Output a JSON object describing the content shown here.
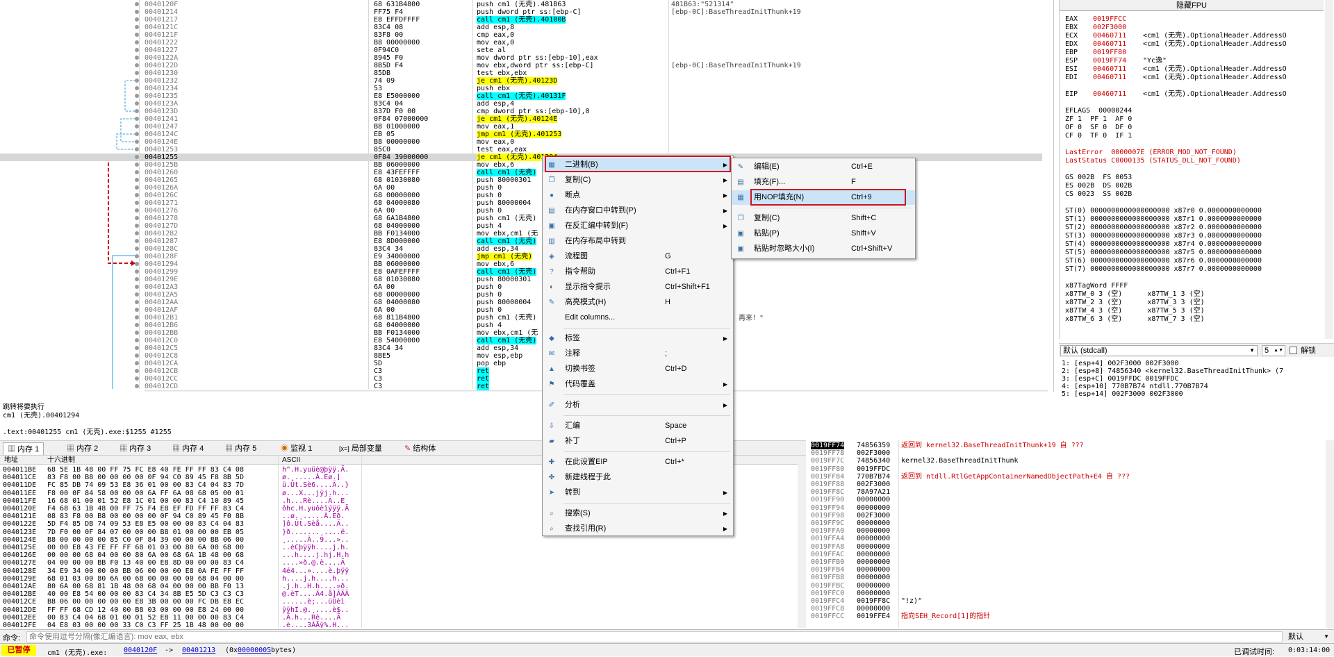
{
  "disasm": {
    "rows": [
      {
        "addr": "0040120F",
        "bytes": "68 631B4800",
        "asm": "push cm1 (无壳).481B63",
        "cmt": "481B63:\"521314\""
      },
      {
        "addr": "00401214",
        "bytes": "FF75 F4",
        "asm": "push dword ptr ss:[ebp-C]",
        "cmt": "[ebp-0C]:BaseThreadInitThunk+19"
      },
      {
        "addr": "00401217",
        "bytes": "E8 EFFDFFFF",
        "asm": "call cm1 (无壳).40100B",
        "cmt": "",
        "hl": "c"
      },
      {
        "addr": "0040121C",
        "bytes": "83C4 08",
        "asm": "add esp,8",
        "cmt": ""
      },
      {
        "addr": "0040121F",
        "bytes": "83F8 00",
        "asm": "cmp eax,0",
        "cmt": ""
      },
      {
        "addr": "00401222",
        "bytes": "B8 00000000",
        "asm": "mov eax,0",
        "cmt": ""
      },
      {
        "addr": "00401227",
        "bytes": "0F94C0",
        "asm": "sete al",
        "cmt": ""
      },
      {
        "addr": "0040122A",
        "bytes": "8945 F0",
        "asm": "mov dword ptr ss:[ebp-10],eax",
        "cmt": ""
      },
      {
        "addr": "0040122D",
        "bytes": "8B5D F4",
        "asm": "mov ebx,dword ptr ss:[ebp-C]",
        "cmt": "[ebp-0C]:BaseThreadInitThunk+19"
      },
      {
        "addr": "00401230",
        "bytes": "85DB",
        "asm": "test ebx,ebx",
        "cmt": ""
      },
      {
        "addr": "00401232",
        "bytes": "74 09",
        "asm": "je cm1 (无壳).40123D",
        "cmt": "",
        "hl": "y"
      },
      {
        "addr": "00401234",
        "bytes": "53",
        "asm": "push ebx",
        "cmt": ""
      },
      {
        "addr": "00401235",
        "bytes": "E8 E5000000",
        "asm": "call cm1 (无壳).40131F",
        "cmt": "",
        "hl": "c"
      },
      {
        "addr": "0040123A",
        "bytes": "83C4 04",
        "asm": "add esp,4",
        "cmt": ""
      },
      {
        "addr": "0040123D",
        "bytes": "837D F0 00",
        "asm": "cmp dword ptr ss:[ebp-10],0",
        "cmt": ""
      },
      {
        "addr": "00401241",
        "bytes": "0F84 07000000",
        "asm": "je cm1 (无壳).40124E",
        "cmt": "",
        "hl": "y"
      },
      {
        "addr": "00401247",
        "bytes": "B8 01000000",
        "asm": "mov eax,1",
        "cmt": ""
      },
      {
        "addr": "0040124C",
        "bytes": "EB 05",
        "asm": "jmp cm1 (无壳).401253",
        "cmt": "",
        "hl": "y"
      },
      {
        "addr": "0040124E",
        "bytes": "B8 00000000",
        "asm": "mov eax,0",
        "cmt": ""
      },
      {
        "addr": "00401253",
        "bytes": "85C0",
        "asm": "test eax,eax",
        "cmt": ""
      },
      {
        "addr": "00401255",
        "bytes": "0F84 39000000",
        "asm": "je cm1 (无壳).401294",
        "cmt": "",
        "hl": "y",
        "sel": true
      },
      {
        "addr": "0040125B",
        "bytes": "BB 06000000",
        "asm": "mov ebx,6",
        "cmt": ""
      },
      {
        "addr": "00401260",
        "bytes": "E8 43FEFFFF",
        "asm": "call cm1 (无壳)",
        "cmt": "",
        "hl": "c"
      },
      {
        "addr": "00401265",
        "bytes": "68 01030080",
        "asm": "push 80000301",
        "cmt": ""
      },
      {
        "addr": "0040126A",
        "bytes": "6A 00",
        "asm": "push 0",
        "cmt": ""
      },
      {
        "addr": "0040126C",
        "bytes": "68 00000000",
        "asm": "push 0",
        "cmt": ""
      },
      {
        "addr": "00401271",
        "bytes": "68 04000080",
        "asm": "push 80000004",
        "cmt": ""
      },
      {
        "addr": "00401276",
        "bytes": "6A 00",
        "asm": "push 0",
        "cmt": ""
      },
      {
        "addr": "00401278",
        "bytes": "68 6A1B4800",
        "asm": "push cm1 (无壳)",
        "cmt": ""
      },
      {
        "addr": "0040127D",
        "bytes": "68 04000000",
        "asm": "push 4",
        "cmt": ""
      },
      {
        "addr": "00401282",
        "bytes": "BB F0134000",
        "asm": "mov ebx,cm1 (无",
        "cmt": ""
      },
      {
        "addr": "00401287",
        "bytes": "E8 8D000000",
        "asm": "call cm1 (无壳)",
        "cmt": "",
        "hl": "c"
      },
      {
        "addr": "0040128C",
        "bytes": "83C4 34",
        "asm": "add esp,34",
        "cmt": ""
      },
      {
        "addr": "0040128F",
        "bytes": "E9 34000000",
        "asm": "jmp cm1 (无壳)",
        "cmt": "",
        "hl": "y"
      },
      {
        "addr": "00401294",
        "bytes": "BB 06000000",
        "asm": "mov ebx,6",
        "cmt": ""
      },
      {
        "addr": "00401299",
        "bytes": "E8 0AFEFFFF",
        "asm": "call cm1 (无壳)",
        "cmt": "",
        "hl": "c"
      },
      {
        "addr": "0040129E",
        "bytes": "68 01030080",
        "asm": "push 80000301",
        "cmt": ""
      },
      {
        "addr": "004012A3",
        "bytes": "6A 00",
        "asm": "push 0",
        "cmt": ""
      },
      {
        "addr": "004012A5",
        "bytes": "68 00000000",
        "asm": "push 0",
        "cmt": ""
      },
      {
        "addr": "004012AA",
        "bytes": "68 04000080",
        "asm": "push 80000004",
        "cmt": ""
      },
      {
        "addr": "004012AF",
        "bytes": "6A 00",
        "asm": "push 0",
        "cmt": ""
      },
      {
        "addr": "004012B1",
        "bytes": "68 811B4800",
        "asm": "push cm1 (无壳)",
        "cmt": ""
      },
      {
        "addr": "004012B6",
        "bytes": "68 04000000",
        "asm": "push 4",
        "cmt": ""
      },
      {
        "addr": "004012BB",
        "bytes": "BB F0134000",
        "asm": "mov ebx,cm1 (无",
        "cmt": ""
      },
      {
        "addr": "004012C0",
        "bytes": "E8 54000000",
        "asm": "call cm1 (无壳)",
        "cmt": "",
        "hl": "c"
      },
      {
        "addr": "004012C5",
        "bytes": "83C4 34",
        "asm": "add esp,34",
        "cmt": ""
      },
      {
        "addr": "004012C8",
        "bytes": "8BE5",
        "asm": "mov esp,ebp",
        "cmt": ""
      },
      {
        "addr": "004012CA",
        "bytes": "5D",
        "asm": "pop ebp",
        "cmt": ""
      },
      {
        "addr": "004012CB",
        "bytes": "C3",
        "asm": "ret",
        "cmt": "",
        "hl": "c"
      },
      {
        "addr": "004012CC",
        "bytes": "C3",
        "asm": "ret",
        "cmt": "",
        "hl": "c"
      },
      {
        "addr": "004012CD",
        "bytes": "C3",
        "asm": "ret",
        "cmt": "",
        "hl": "c"
      }
    ],
    "side_comment": "败，再来！\""
  },
  "info": {
    "line1": "跳转将要执行",
    "line2": "cm1 (无壳).00401294",
    "line3": ".text:00401255 cm1 (无壳).exe:$1255 #1255"
  },
  "tabs": [
    "内存 1",
    "内存 2",
    "内存 3",
    "内存 4",
    "内存 5",
    "监视 1",
    "局部变量",
    "结构体"
  ],
  "tabs_prefix_locals": "[x=]",
  "dump": {
    "header_addr": "地址",
    "header_hex": "十六进制",
    "header_ascii": "ASCII",
    "rows": [
      {
        "a": "004011BE",
        "h": "68 5E 1B 48 00 FF 75 FC E8 40 FE FF FF 83 C4 08",
        "s": "h^.H.yuüè@þÿÿ.Ä."
      },
      {
        "a": "004011CE",
        "h": "83 F8 00 B8 00 00 00 00 0F 94 C0 89 45 F8 8B 5D",
        "s": "ø.¸.....À.Eø.]"
      },
      {
        "a": "004011DE",
        "h": "FC 85 DB 74 09 53 E8 36 01 00 00 83 C4 04 83 7D",
        "s": "ü.Ût.Sè6....Ä..}"
      },
      {
        "a": "004011EE",
        "h": "F8 00 0F 84 58 00 00 00 6A FF 6A 08 68 05 00 01",
        "s": "ø...X...jÿj.h..."
      },
      {
        "a": "004011FE",
        "h": "16 68 01 00 01 52 E8 1C 01 00 00 83 C4 10 89 45",
        "s": ".h...Rè....Ä..E"
      },
      {
        "a": "0040120E",
        "h": "F4 68 63 1B 48 00 FF 75 F4 E8 EF FD FF FF 83 C4",
        "s": "ôhc.H.yuôèïýÿÿ.Ä"
      },
      {
        "a": "0040121E",
        "h": "08 83 F8 00 B8 00 00 00 00 0F 94 C0 89 45 F0 8B",
        "s": "..ø.¸.....À.Eð."
      },
      {
        "a": "0040122E",
        "h": "5D F4 85 DB 74 09 53 E8 E5 00 00 00 83 C4 04 83",
        "s": "]ô.Ût.Sèå....Ä.."
      },
      {
        "a": "0040123E",
        "h": "7D F0 00 0F 84 07 00 00 00 B8 01 00 00 00 EB 05",
        "s": "}ð.......¸....ë."
      },
      {
        "a": "0040124E",
        "h": "B8 00 00 00 00 85 C0 0F 84 39 00 00 00 BB 06 00",
        "s": "¸.....À..9...».."
      },
      {
        "a": "0040125E",
        "h": "00 00 E8 43 FE FF FF 68 01 03 00 80 6A 00 68 00",
        "s": "..èCþÿÿh....j.h."
      },
      {
        "a": "0040126E",
        "h": "00 00 00 68 04 00 00 80 6A 00 68 6A 1B 48 00 68",
        "s": "...h....j.hj.H.h"
      },
      {
        "a": "0040127E",
        "h": "04 00 00 00 BB F0 13 40 00 E8 8D 00 00 00 83 C4",
        "s": "....»ð.@.è....Ä"
      },
      {
        "a": "0040128E",
        "h": "34 E9 34 00 00 00 BB 06 00 00 00 E8 0A FE FF FF",
        "s": "4é4...»....è.þÿÿ"
      },
      {
        "a": "0040129E",
        "h": "68 01 03 00 80 6A 00 68 00 00 00 00 68 04 00 00",
        "s": "h....j.h....h..."
      },
      {
        "a": "004012AE",
        "h": "80 6A 00 68 81 1B 48 00 68 04 00 00 00 BB F0 13",
        "s": ".j.h..H.h....»ð."
      },
      {
        "a": "004012BE",
        "h": "40 00 E8 54 00 00 00 83 C4 34 8B E5 5D C3 C3 C3",
        "s": "@.èT....Ä4.å]ÃÃÃ"
      },
      {
        "a": "004012CE",
        "h": "B8 06 00 00 00 00 00 E8 3B 00 00 00 FC DB E8 EC",
        "s": "......è;...üÛèì"
      },
      {
        "a": "004012DE",
        "h": "FF FF 68 CD 12 40 00 B8 03 00 00 00 E8 24 00 00",
        "s": "ÿÿhÍ.@.¸....è$.."
      },
      {
        "a": "004012EE",
        "h": "00 83 C4 04 68 01 00 01 52 E8 11 00 00 00 83 C4",
        "s": ".Ä.h...Rè....Ä"
      },
      {
        "a": "004012FE",
        "h": "04 E8 03 00 00 00 33 C0 C3 FF 25 1B 48 00 00 00",
        "s": ".è....3ÀÃÿ%.H..."
      }
    ]
  },
  "regs": {
    "title": "隐藏FPU",
    "lines": [
      {
        "n": "EAX",
        "v": "0019FFCC",
        "c": ""
      },
      {
        "n": "EBX",
        "v": "002F3000",
        "c": ""
      },
      {
        "n": "ECX",
        "v": "00460711",
        "c": "<cm1 (无壳).OptionalHeader.AddressO"
      },
      {
        "n": "EDX",
        "v": "00460711",
        "c": "<cm1 (无壳).OptionalHeader.AddressO"
      },
      {
        "n": "EBP",
        "v": "0019FF80",
        "c": ""
      },
      {
        "n": "ESP",
        "v": "0019FF74",
        "c": "\"Yc逸\""
      },
      {
        "n": "ESI",
        "v": "00460711",
        "c": "<cm1 (无壳).OptionalHeader.AddressO"
      },
      {
        "n": "EDI",
        "v": "00460711",
        "c": "<cm1 (无壳).OptionalHeader.AddressO"
      },
      {
        "n": "",
        "v": "",
        "c": ""
      },
      {
        "n": "EIP",
        "v": "00460711",
        "c": "<cm1 (无壳).OptionalHeader.AddressO"
      }
    ],
    "eflags": "EFLAGS  00000244",
    "flags": [
      "ZF 1  PF 1  AF 0",
      "OF 0  SF 0  DF 0",
      "CF 0  TF 0  IF 1"
    ],
    "lasterror": "LastError  0000007E (ERROR_MOD_NOT_FOUND)",
    "laststatus": "LastStatus C0000135 (STATUS_DLL_NOT_FOUND)",
    "seg": [
      "GS 002B  FS 0053",
      "ES 002B  DS 002B",
      "CS 0023  SS 002B"
    ],
    "st": [
      "ST(0) 0000000000000000000 x87r0 0.0000000000000",
      "ST(1) 0000000000000000000 x87r1 0.0000000000000",
      "ST(2) 0000000000000000000 x87r2 0.0000000000000",
      "ST(3) 0000000000000000000 x87r3 0.0000000000000",
      "ST(4) 0000000000000000000 x87r4 0.0000000000000",
      "ST(5) 0000000000000000000 x87r5 0.0000000000000",
      "ST(6) 0000000000000000000 x87r6 0.0000000000000",
      "ST(7) 0000000000000000000 x87r7 0.0000000000000"
    ],
    "tag": [
      "x87TagWord FFFF",
      "x87TW_0 3 (空)      x87TW_1 3 (空)",
      "x87TW_2 3 (空)      x87TW_3 3 (空)",
      "x87TW_4 3 (空)      x87TW_5 3 (空)",
      "x87TW_6 3 (空)      x87TW_7 3 (空)"
    ]
  },
  "callconv": {
    "value": "默认 (stdcall)",
    "count": "5",
    "unlock": "解锁"
  },
  "args": [
    "1: [esp+4] 002F3000 002F3000",
    "2: [esp+8] 74856340 <kernel32.BaseThreadInitThunk> (7",
    "3: [esp+C] 0019FFDC 0019FFDC",
    "4: [esp+10] 770B7B74 ntdll.770B7B74",
    "5: [esp+14] 002F3000 002F3000"
  ],
  "stack": [
    {
      "a": "0019FF74",
      "v": "74856359",
      "c": "返回到 kernel32.BaseThreadInitThunk+19 自 ???",
      "cur": true,
      "red": true
    },
    {
      "a": "0019FF78",
      "v": "002F3000",
      "c": ""
    },
    {
      "a": "0019FF7C",
      "v": "74856340",
      "c": "kernel32.BaseThreadInitThunk"
    },
    {
      "a": "0019FF80",
      "v": "0019FFDC",
      "c": ""
    },
    {
      "a": "0019FF84",
      "v": "770B7B74",
      "c": "返回到 ntdll.RtlGetAppContainerNamedObjectPath+E4 自 ???",
      "red": true
    },
    {
      "a": "0019FF88",
      "v": "002F3000",
      "c": ""
    },
    {
      "a": "0019FF8C",
      "v": "78A97A21",
      "c": ""
    },
    {
      "a": "0019FF90",
      "v": "00000000",
      "c": ""
    },
    {
      "a": "0019FF94",
      "v": "00000000",
      "c": ""
    },
    {
      "a": "0019FF98",
      "v": "002F3000",
      "c": ""
    },
    {
      "a": "0019FF9C",
      "v": "00000000",
      "c": ""
    },
    {
      "a": "0019FFA0",
      "v": "00000000",
      "c": ""
    },
    {
      "a": "0019FFA4",
      "v": "00000000",
      "c": ""
    },
    {
      "a": "0019FFA8",
      "v": "00000000",
      "c": ""
    },
    {
      "a": "0019FFAC",
      "v": "00000000",
      "c": ""
    },
    {
      "a": "0019FFB0",
      "v": "00000000",
      "c": ""
    },
    {
      "a": "0019FFB4",
      "v": "00000000",
      "c": ""
    },
    {
      "a": "0019FFB8",
      "v": "00000000",
      "c": ""
    },
    {
      "a": "0019FFBC",
      "v": "00000000",
      "c": ""
    },
    {
      "a": "0019FFC0",
      "v": "00000000",
      "c": ""
    },
    {
      "a": "0019FFC4",
      "v": "0019FF8C",
      "c": "\"!z)\""
    },
    {
      "a": "0019FFC8",
      "v": "00000000",
      "c": ""
    },
    {
      "a": "0019FFCC",
      "v": "0019FFE4",
      "c": "指向SEH_Record[1]的指针",
      "red": true
    }
  ],
  "cmd": {
    "label": "命令:",
    "placeholder": "命令使用逗号分隔(像汇编语言): mov eax, ebx",
    "right": "默认"
  },
  "status": {
    "state": "已暂停",
    "file": "cm1 (无壳).exe:",
    "from": "0040120F",
    "arrow": "->",
    "to": "00401213",
    "size_pre": "(0x",
    "size": "00000005",
    "size_post": " bytes)",
    "time_label": "已调试时间:",
    "time": "0:03:14:00"
  },
  "menu1": [
    {
      "label": "二进制(B)",
      "sc": "",
      "sub": true,
      "icon": "▦",
      "hover": true
    },
    {
      "label": "复制(C)",
      "sc": "",
      "sub": true,
      "icon": "❐"
    },
    {
      "label": "断点",
      "sc": "",
      "sub": true,
      "icon": "●"
    },
    {
      "label": "在内存窗口中转到(P)",
      "sc": "",
      "sub": true,
      "icon": "▤"
    },
    {
      "label": "在反汇编中转到(F)",
      "sc": "",
      "sub": true,
      "icon": "▣"
    },
    {
      "label": "在内存布局中转到",
      "sc": "",
      "sub": false,
      "icon": "▥"
    },
    {
      "label": "流程图",
      "sc": "G",
      "sub": false,
      "icon": "◈"
    },
    {
      "label": "指令帮助",
      "sc": "Ctrl+F1",
      "sub": false,
      "icon": "?"
    },
    {
      "label": "显示指令提示",
      "sc": "Ctrl+Shift+F1",
      "sub": false,
      "icon": "◐"
    },
    {
      "label": "高亮模式(H)",
      "sc": "H",
      "sub": false,
      "icon": "✎"
    },
    {
      "label": "Edit columns...",
      "sc": "",
      "sub": false,
      "icon": ""
    },
    {
      "sep": true
    },
    {
      "label": "标签",
      "sc": "",
      "sub": true,
      "icon": "◆"
    },
    {
      "label": "注释",
      "sc": ";",
      "sub": false,
      "icon": "✉"
    },
    {
      "label": "切换书签",
      "sc": "Ctrl+D",
      "sub": false,
      "icon": "▲"
    },
    {
      "label": "代码覆盖",
      "sc": "",
      "sub": true,
      "icon": "⚑"
    },
    {
      "sep": true
    },
    {
      "label": "分析",
      "sc": "",
      "sub": true,
      "icon": "✐"
    },
    {
      "sep": true
    },
    {
      "label": "汇编",
      "sc": "Space",
      "sub": false,
      "icon": "⇩"
    },
    {
      "label": "补丁",
      "sc": "Ctrl+P",
      "sub": false,
      "icon": "▰"
    },
    {
      "sep": true
    },
    {
      "label": "在此设置EIP",
      "sc": "Ctrl+*",
      "sub": false,
      "icon": "✚"
    },
    {
      "label": "新建线程于此",
      "sc": "",
      "sub": false,
      "icon": "✤"
    },
    {
      "label": "转到",
      "sc": "",
      "sub": true,
      "icon": "➤"
    },
    {
      "sep": true
    },
    {
      "label": "搜索(S)",
      "sc": "",
      "sub": true,
      "icon": "⌕"
    },
    {
      "label": "查找引用(R)",
      "sc": "",
      "sub": true,
      "icon": "⌕"
    }
  ],
  "menu2": [
    {
      "label": "编辑(E)",
      "sc": "Ctrl+E",
      "icon": "✎"
    },
    {
      "label": "填充(F)...",
      "sc": "F",
      "icon": "▤"
    },
    {
      "label": "用NOP填充(N)",
      "sc": "Ctrl+9",
      "icon": "▦",
      "hover": true
    },
    {
      "sep": true
    },
    {
      "label": "复制(C)",
      "sc": "Shift+C",
      "icon": "❐"
    },
    {
      "label": "粘贴(P)",
      "sc": "Shift+V",
      "icon": "▣"
    },
    {
      "label": "粘贴时忽略大小(I)",
      "sc": "Ctrl+Shift+V",
      "icon": "▣"
    }
  ],
  "colors": {
    "red": "#d00000",
    "yellow": "#ffff00",
    "cyan": "#00ffff",
    "highlight_box": "#d0101e"
  }
}
